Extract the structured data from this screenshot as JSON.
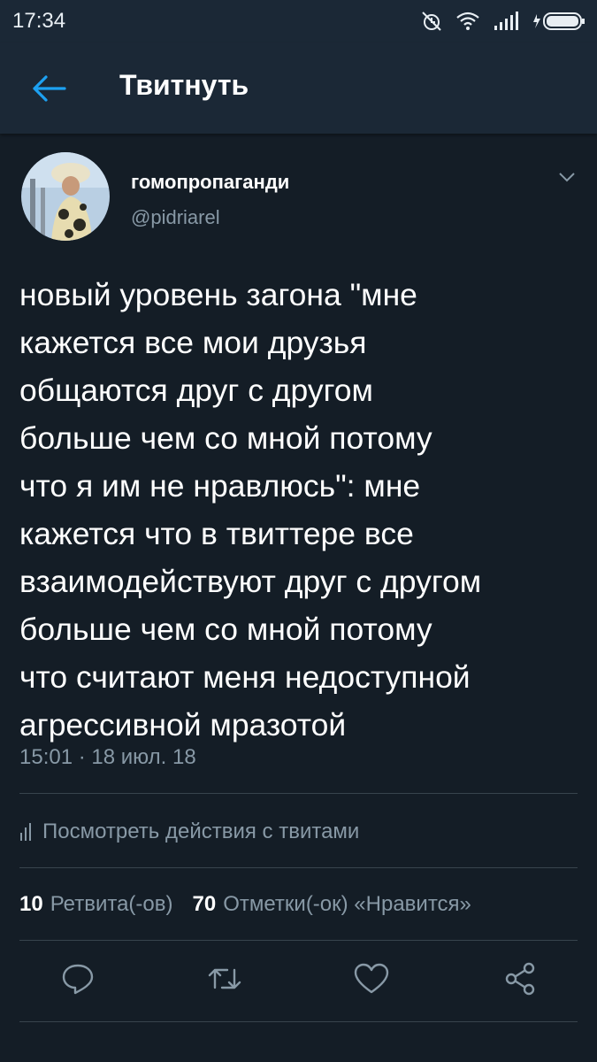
{
  "status_bar": {
    "time": "17:34"
  },
  "app_bar": {
    "title": "Твитнуть",
    "back_icon": "arrow-left-icon"
  },
  "author": {
    "name": "гомопропаганди",
    "handle": "@pidriarel"
  },
  "tweet": {
    "lines": [
      "новый уровень загона \"мне",
      "кажется все мои друзья",
      "общаются друг с другом",
      "больше чем со мной потому",
      "что я им не нравлюсь\": мне",
      "кажется что в твиттере все",
      "взаимодействуют друг с другом",
      "больше чем со мной потому",
      "что считают меня недоступной",
      "агрессивной мразотой"
    ],
    "timestamp": "15:01 · 18 июл. 18"
  },
  "activity": {
    "label": "Посмотреть действия с твитами"
  },
  "stats": {
    "retweets_count": "10",
    "retweets_label": "Ретвита(-ов)",
    "likes_count": "70",
    "likes_label": "Отметки(-ок) «Нравится»"
  },
  "actions": [
    "reply-icon",
    "retweet-icon",
    "like-icon",
    "share-icon"
  ],
  "colors": {
    "background": "#141d26",
    "bar": "#1b2836",
    "accent": "#1da1f2",
    "muted": "#8899a6"
  }
}
